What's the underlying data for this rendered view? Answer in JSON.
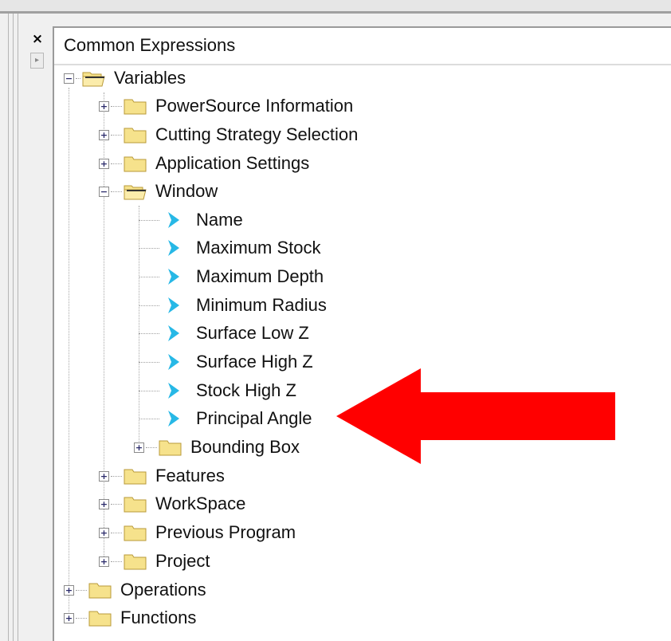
{
  "panel": {
    "close_label": "×",
    "scroll_label": "▸",
    "title": "Common Expressions"
  },
  "tree": {
    "variables": "Variables",
    "powersource": "PowerSource Information",
    "cutting": "Cutting Strategy Selection",
    "application": "Application Settings",
    "window": "Window",
    "window_items": [
      "Name",
      "Maximum Stock",
      "Maximum Depth",
      "Minimum Radius",
      "Surface Low Z",
      "Surface High Z",
      "Stock High Z",
      "Principal Angle"
    ],
    "bounding_box": "Bounding Box",
    "features": "Features",
    "workspace": "WorkSpace",
    "previous_program": "Previous Program",
    "project": "Project",
    "operations": "Operations",
    "functions": "Functions"
  },
  "colors": {
    "folder_fill": "#f6e28c",
    "folder_stroke": "#b89a3a",
    "leaf_arrow": "#27b8e6",
    "annotation_arrow": "#ff0000"
  },
  "icons": {
    "folder_closed": "folder-icon",
    "folder_open": "folder-open-icon",
    "leaf": "variable-arrow-icon",
    "annotation": "red-arrow-annotation"
  }
}
